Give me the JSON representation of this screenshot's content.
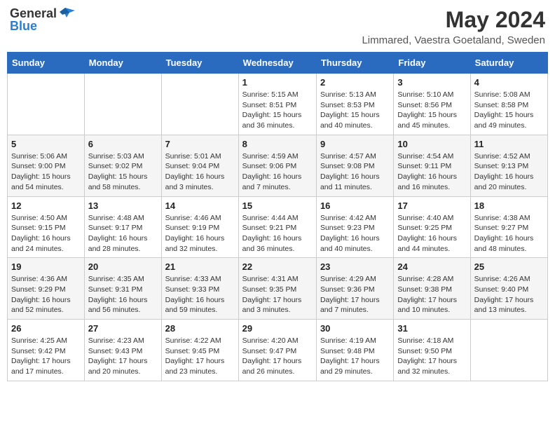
{
  "header": {
    "logo_general": "General",
    "logo_blue": "Blue",
    "month": "May 2024",
    "location": "Limmared, Vaestra Goetaland, Sweden"
  },
  "weekdays": [
    "Sunday",
    "Monday",
    "Tuesday",
    "Wednesday",
    "Thursday",
    "Friday",
    "Saturday"
  ],
  "weeks": [
    [
      {
        "day": "",
        "info": ""
      },
      {
        "day": "",
        "info": ""
      },
      {
        "day": "",
        "info": ""
      },
      {
        "day": "1",
        "info": "Sunrise: 5:15 AM\nSunset: 8:51 PM\nDaylight: 15 hours and 36 minutes."
      },
      {
        "day": "2",
        "info": "Sunrise: 5:13 AM\nSunset: 8:53 PM\nDaylight: 15 hours and 40 minutes."
      },
      {
        "day": "3",
        "info": "Sunrise: 5:10 AM\nSunset: 8:56 PM\nDaylight: 15 hours and 45 minutes."
      },
      {
        "day": "4",
        "info": "Sunrise: 5:08 AM\nSunset: 8:58 PM\nDaylight: 15 hours and 49 minutes."
      }
    ],
    [
      {
        "day": "5",
        "info": "Sunrise: 5:06 AM\nSunset: 9:00 PM\nDaylight: 15 hours and 54 minutes."
      },
      {
        "day": "6",
        "info": "Sunrise: 5:03 AM\nSunset: 9:02 PM\nDaylight: 15 hours and 58 minutes."
      },
      {
        "day": "7",
        "info": "Sunrise: 5:01 AM\nSunset: 9:04 PM\nDaylight: 16 hours and 3 minutes."
      },
      {
        "day": "8",
        "info": "Sunrise: 4:59 AM\nSunset: 9:06 PM\nDaylight: 16 hours and 7 minutes."
      },
      {
        "day": "9",
        "info": "Sunrise: 4:57 AM\nSunset: 9:08 PM\nDaylight: 16 hours and 11 minutes."
      },
      {
        "day": "10",
        "info": "Sunrise: 4:54 AM\nSunset: 9:11 PM\nDaylight: 16 hours and 16 minutes."
      },
      {
        "day": "11",
        "info": "Sunrise: 4:52 AM\nSunset: 9:13 PM\nDaylight: 16 hours and 20 minutes."
      }
    ],
    [
      {
        "day": "12",
        "info": "Sunrise: 4:50 AM\nSunset: 9:15 PM\nDaylight: 16 hours and 24 minutes."
      },
      {
        "day": "13",
        "info": "Sunrise: 4:48 AM\nSunset: 9:17 PM\nDaylight: 16 hours and 28 minutes."
      },
      {
        "day": "14",
        "info": "Sunrise: 4:46 AM\nSunset: 9:19 PM\nDaylight: 16 hours and 32 minutes."
      },
      {
        "day": "15",
        "info": "Sunrise: 4:44 AM\nSunset: 9:21 PM\nDaylight: 16 hours and 36 minutes."
      },
      {
        "day": "16",
        "info": "Sunrise: 4:42 AM\nSunset: 9:23 PM\nDaylight: 16 hours and 40 minutes."
      },
      {
        "day": "17",
        "info": "Sunrise: 4:40 AM\nSunset: 9:25 PM\nDaylight: 16 hours and 44 minutes."
      },
      {
        "day": "18",
        "info": "Sunrise: 4:38 AM\nSunset: 9:27 PM\nDaylight: 16 hours and 48 minutes."
      }
    ],
    [
      {
        "day": "19",
        "info": "Sunrise: 4:36 AM\nSunset: 9:29 PM\nDaylight: 16 hours and 52 minutes."
      },
      {
        "day": "20",
        "info": "Sunrise: 4:35 AM\nSunset: 9:31 PM\nDaylight: 16 hours and 56 minutes."
      },
      {
        "day": "21",
        "info": "Sunrise: 4:33 AM\nSunset: 9:33 PM\nDaylight: 16 hours and 59 minutes."
      },
      {
        "day": "22",
        "info": "Sunrise: 4:31 AM\nSunset: 9:35 PM\nDaylight: 17 hours and 3 minutes."
      },
      {
        "day": "23",
        "info": "Sunrise: 4:29 AM\nSunset: 9:36 PM\nDaylight: 17 hours and 7 minutes."
      },
      {
        "day": "24",
        "info": "Sunrise: 4:28 AM\nSunset: 9:38 PM\nDaylight: 17 hours and 10 minutes."
      },
      {
        "day": "25",
        "info": "Sunrise: 4:26 AM\nSunset: 9:40 PM\nDaylight: 17 hours and 13 minutes."
      }
    ],
    [
      {
        "day": "26",
        "info": "Sunrise: 4:25 AM\nSunset: 9:42 PM\nDaylight: 17 hours and 17 minutes."
      },
      {
        "day": "27",
        "info": "Sunrise: 4:23 AM\nSunset: 9:43 PM\nDaylight: 17 hours and 20 minutes."
      },
      {
        "day": "28",
        "info": "Sunrise: 4:22 AM\nSunset: 9:45 PM\nDaylight: 17 hours and 23 minutes."
      },
      {
        "day": "29",
        "info": "Sunrise: 4:20 AM\nSunset: 9:47 PM\nDaylight: 17 hours and 26 minutes."
      },
      {
        "day": "30",
        "info": "Sunrise: 4:19 AM\nSunset: 9:48 PM\nDaylight: 17 hours and 29 minutes."
      },
      {
        "day": "31",
        "info": "Sunrise: 4:18 AM\nSunset: 9:50 PM\nDaylight: 17 hours and 32 minutes."
      },
      {
        "day": "",
        "info": ""
      }
    ]
  ]
}
